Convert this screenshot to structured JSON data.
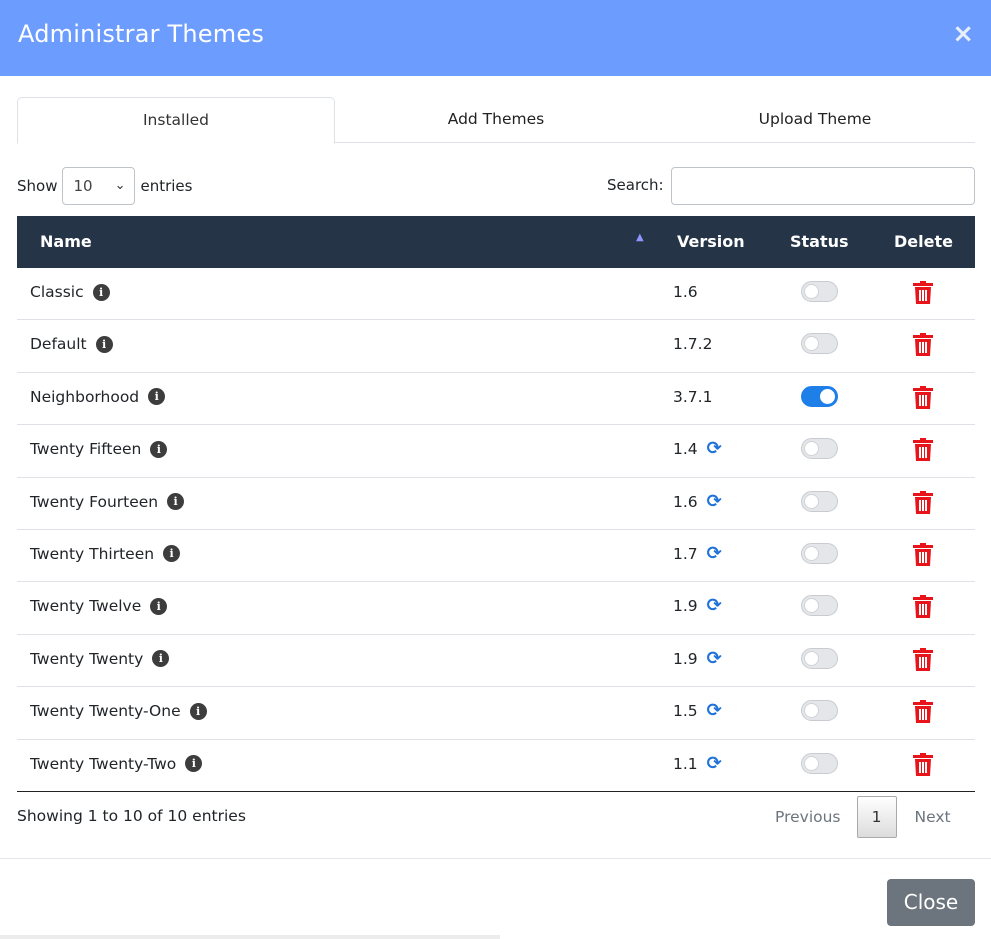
{
  "modal": {
    "title": "Administrar Themes",
    "close_symbol": "×"
  },
  "tabs": [
    {
      "label": "Installed",
      "active": true
    },
    {
      "label": "Add Themes",
      "active": false
    },
    {
      "label": "Upload Theme",
      "active": false
    }
  ],
  "length": {
    "show_label": "Show",
    "value": "10",
    "entries_label": "entries"
  },
  "search": {
    "label": "Search:",
    "value": ""
  },
  "table": {
    "columns": [
      "Name",
      "Version",
      "Status",
      "Delete"
    ],
    "rows": [
      {
        "name": "Classic",
        "version": "1.6",
        "update": false,
        "active": false
      },
      {
        "name": "Default",
        "version": "1.7.2",
        "update": false,
        "active": false
      },
      {
        "name": "Neighborhood",
        "version": "3.7.1",
        "update": false,
        "active": true
      },
      {
        "name": "Twenty Fifteen",
        "version": "1.4",
        "update": true,
        "active": false
      },
      {
        "name": "Twenty Fourteen",
        "version": "1.6",
        "update": true,
        "active": false
      },
      {
        "name": "Twenty Thirteen",
        "version": "1.7",
        "update": true,
        "active": false
      },
      {
        "name": "Twenty Twelve",
        "version": "1.9",
        "update": true,
        "active": false
      },
      {
        "name": "Twenty Twenty",
        "version": "1.9",
        "update": true,
        "active": false
      },
      {
        "name": "Twenty Twenty-One",
        "version": "1.5",
        "update": true,
        "active": false
      },
      {
        "name": "Twenty Twenty-Two",
        "version": "1.1",
        "update": true,
        "active": false
      }
    ]
  },
  "info": "Showing 1 to 10 of 10 entries",
  "pagination": {
    "previous": "Previous",
    "current": "1",
    "next": "Next"
  },
  "footer": {
    "close_label": "Close"
  },
  "colors": {
    "header": "#6c9cfd",
    "table_head": "#253446",
    "toggle_on": "#1f7fe9",
    "delete": "#e8141a",
    "update": "#1f72d8"
  },
  "icons": {
    "info": "info-circle-icon",
    "update": "refresh-icon",
    "delete": "trash-icon",
    "sort": "sort-asc-icon"
  }
}
